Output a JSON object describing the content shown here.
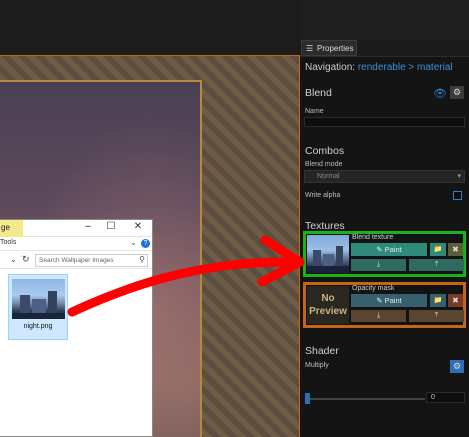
{
  "explorer": {
    "tab_label": "ge",
    "ribbon_label": "Tools",
    "search_placeholder": "Search Wallpaper Images",
    "file_name": "night.png"
  },
  "panel": {
    "tab_label": "Properties",
    "navigation_label": "Navigation:",
    "nav_link_1": "renderable",
    "nav_sep": ">",
    "nav_link_2": "material",
    "blend_header": "Blend",
    "name_label": "Name",
    "combos_header": "Combos",
    "blend_mode_label": "Blend mode",
    "blend_mode_value": "Normal",
    "write_alpha_label": "Write alpha",
    "textures_header": "Textures",
    "blend_texture_label": "Blend texture",
    "opacity_mask_label": "Opacity mask",
    "no_preview_text": "No Preview",
    "paint_label": "Paint",
    "shader_header": "Shader",
    "shader_value": "Multiply",
    "slider_value": "0"
  },
  "colors": {
    "accent_blue": "#2e7fd0",
    "highlight_green": "#19b219",
    "highlight_orange": "#c4651a",
    "arrow_red": "#ff0000"
  }
}
